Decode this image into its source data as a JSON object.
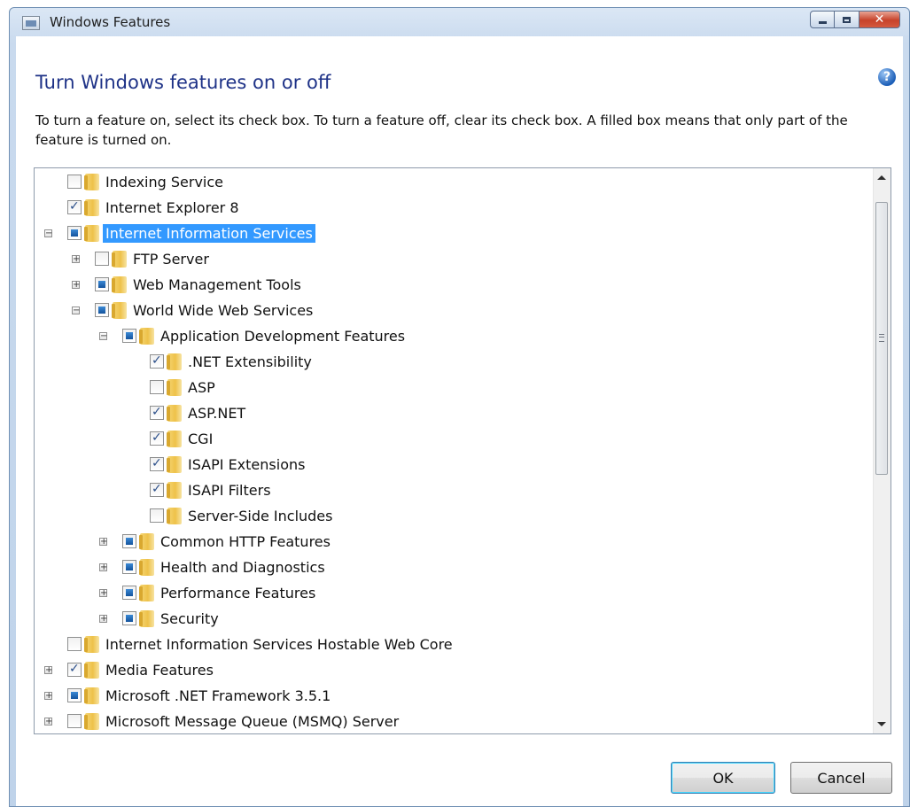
{
  "window": {
    "title": "Windows Features",
    "caption_buttons": {
      "minimize": "–",
      "maximize": "□",
      "close": "✕"
    }
  },
  "heading": "Turn Windows features on or off",
  "help": "?",
  "description": "To turn a feature on, select its check box. To turn a feature off, clear its check box. A filled box means that only part of the feature is turned on.",
  "tree": {
    "items": [
      {
        "label": "Indexing Service",
        "level": 0,
        "state": "unchecked",
        "expander": "none",
        "selected": false
      },
      {
        "label": "Internet Explorer 8",
        "level": 0,
        "state": "checked",
        "expander": "none",
        "selected": false
      },
      {
        "label": "Internet Information Services",
        "level": 0,
        "state": "partial",
        "expander": "collapse",
        "selected": true
      },
      {
        "label": "FTP Server",
        "level": 1,
        "state": "unchecked",
        "expander": "expand",
        "selected": false
      },
      {
        "label": "Web Management Tools",
        "level": 1,
        "state": "partial",
        "expander": "expand",
        "selected": false
      },
      {
        "label": "World Wide Web Services",
        "level": 1,
        "state": "partial",
        "expander": "collapse",
        "selected": false
      },
      {
        "label": "Application Development Features",
        "level": 2,
        "state": "partial",
        "expander": "collapse",
        "selected": false
      },
      {
        "label": ".NET Extensibility",
        "level": 3,
        "state": "checked",
        "expander": "none",
        "selected": false
      },
      {
        "label": "ASP",
        "level": 3,
        "state": "unchecked",
        "expander": "none",
        "selected": false
      },
      {
        "label": "ASP.NET",
        "level": 3,
        "state": "checked",
        "expander": "none",
        "selected": false
      },
      {
        "label": "CGI",
        "level": 3,
        "state": "checked",
        "expander": "none",
        "selected": false
      },
      {
        "label": "ISAPI Extensions",
        "level": 3,
        "state": "checked",
        "expander": "none",
        "selected": false
      },
      {
        "label": "ISAPI Filters",
        "level": 3,
        "state": "checked",
        "expander": "none",
        "selected": false
      },
      {
        "label": "Server-Side Includes",
        "level": 3,
        "state": "unchecked",
        "expander": "none",
        "selected": false
      },
      {
        "label": "Common HTTP Features",
        "level": 2,
        "state": "partial",
        "expander": "expand",
        "selected": false
      },
      {
        "label": "Health and Diagnostics",
        "level": 2,
        "state": "partial",
        "expander": "expand",
        "selected": false
      },
      {
        "label": "Performance Features",
        "level": 2,
        "state": "partial",
        "expander": "expand",
        "selected": false
      },
      {
        "label": "Security",
        "level": 2,
        "state": "partial",
        "expander": "expand",
        "selected": false
      },
      {
        "label": "Internet Information Services Hostable Web Core",
        "level": 0,
        "state": "unchecked",
        "expander": "none",
        "selected": false
      },
      {
        "label": "Media Features",
        "level": 0,
        "state": "checked",
        "expander": "expand",
        "selected": false
      },
      {
        "label": "Microsoft .NET Framework 3.5.1",
        "level": 0,
        "state": "partial",
        "expander": "expand",
        "selected": false
      },
      {
        "label": "Microsoft Message Queue (MSMQ) Server",
        "level": 0,
        "state": "unchecked",
        "expander": "expand",
        "selected": false
      }
    ]
  },
  "buttons": {
    "ok": "OK",
    "cancel": "Cancel"
  },
  "colors": {
    "heading": "#1e3287",
    "selection": "#3399ff",
    "close_button": "#c7422a"
  }
}
